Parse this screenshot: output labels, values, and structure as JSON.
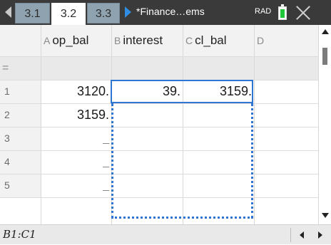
{
  "tabs": [
    {
      "label": "3.1"
    },
    {
      "label": "3.2",
      "active": true
    },
    {
      "label": "3.3"
    }
  ],
  "document": {
    "title": "*Finance…ems"
  },
  "mode": "RAD",
  "battery_level": 0.8,
  "columns": [
    {
      "letter": "A",
      "name": "op_bal"
    },
    {
      "letter": "B",
      "name": "interest"
    },
    {
      "letter": "C",
      "name": "cl_bal"
    },
    {
      "letter": "D",
      "name": ""
    }
  ],
  "formula_row_label": "=",
  "rows": [
    {
      "num": "1",
      "a": "3120.",
      "b": "39.",
      "c": "3159."
    },
    {
      "num": "2",
      "a": "3159.",
      "b": "",
      "c": ""
    },
    {
      "num": "3",
      "a": "_",
      "b": "",
      "c": ""
    },
    {
      "num": "4",
      "a": "_",
      "b": "",
      "c": ""
    },
    {
      "num": "5",
      "a": "_",
      "b": "",
      "c": ""
    }
  ],
  "status": {
    "cell_reference": "B1:C1"
  },
  "colors": {
    "accent": "#2f75d2",
    "battery": "#1fc63a",
    "topbar": "#3a3a3a"
  }
}
